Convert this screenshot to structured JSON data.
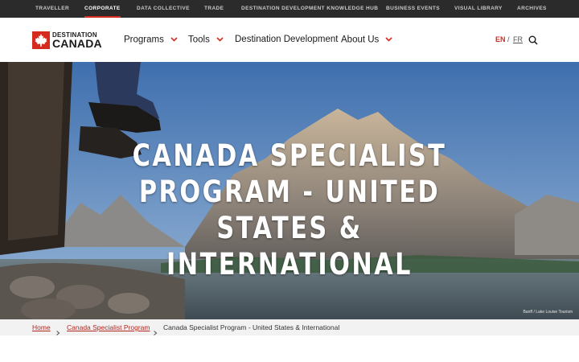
{
  "topbar": {
    "items": [
      {
        "label": "TRAVELLER",
        "active": false
      },
      {
        "label": "CORPORATE",
        "active": true
      },
      {
        "label": "DATA COLLECTIVE",
        "active": false
      },
      {
        "label": "TRADE",
        "active": false
      },
      {
        "label": "DESTINATION DEVELOPMENT KNOWLEDGE HUB",
        "active": false
      },
      {
        "label": "BUSINESS EVENTS",
        "active": false
      },
      {
        "label": "VISUAL LIBRARY",
        "active": false
      },
      {
        "label": "ARCHIVES",
        "active": false
      }
    ]
  },
  "logo": {
    "line1": "DESTINATION",
    "line2": "CANADA"
  },
  "nav": {
    "items": [
      {
        "label": "Programs",
        "has_dropdown": true,
        "icon": "chevron-down-icon"
      },
      {
        "label": "Tools",
        "has_dropdown": true,
        "icon": "chevron-down-icon"
      },
      {
        "label": "Destination Development",
        "has_dropdown": false
      },
      {
        "label": "About Us",
        "has_dropdown": true,
        "icon": "chevron-down-icon"
      }
    ],
    "lang": {
      "en": "EN",
      "separator": "/",
      "fr": "FR",
      "active": "EN"
    },
    "search_icon": "search-icon"
  },
  "hero": {
    "title": "CANADA SPECIALIST PROGRAM - UNITED STATES & INTERNATIONAL",
    "photo_credit": "Banff / Lake Louise Tourism"
  },
  "breadcrumb": {
    "items": [
      {
        "label": "Home",
        "link": true
      },
      {
        "label": "Canada Specialist Program",
        "link": true
      },
      {
        "label": "Canada Specialist Program - United States & International",
        "link": false
      }
    ],
    "separator_icon": "chevron-right-icon"
  },
  "colors": {
    "accent": "#d52b1e",
    "topbar_bg": "#2b2b2b",
    "breadcrumb_bg": "#f2f2f2",
    "link": "#b3261e"
  }
}
